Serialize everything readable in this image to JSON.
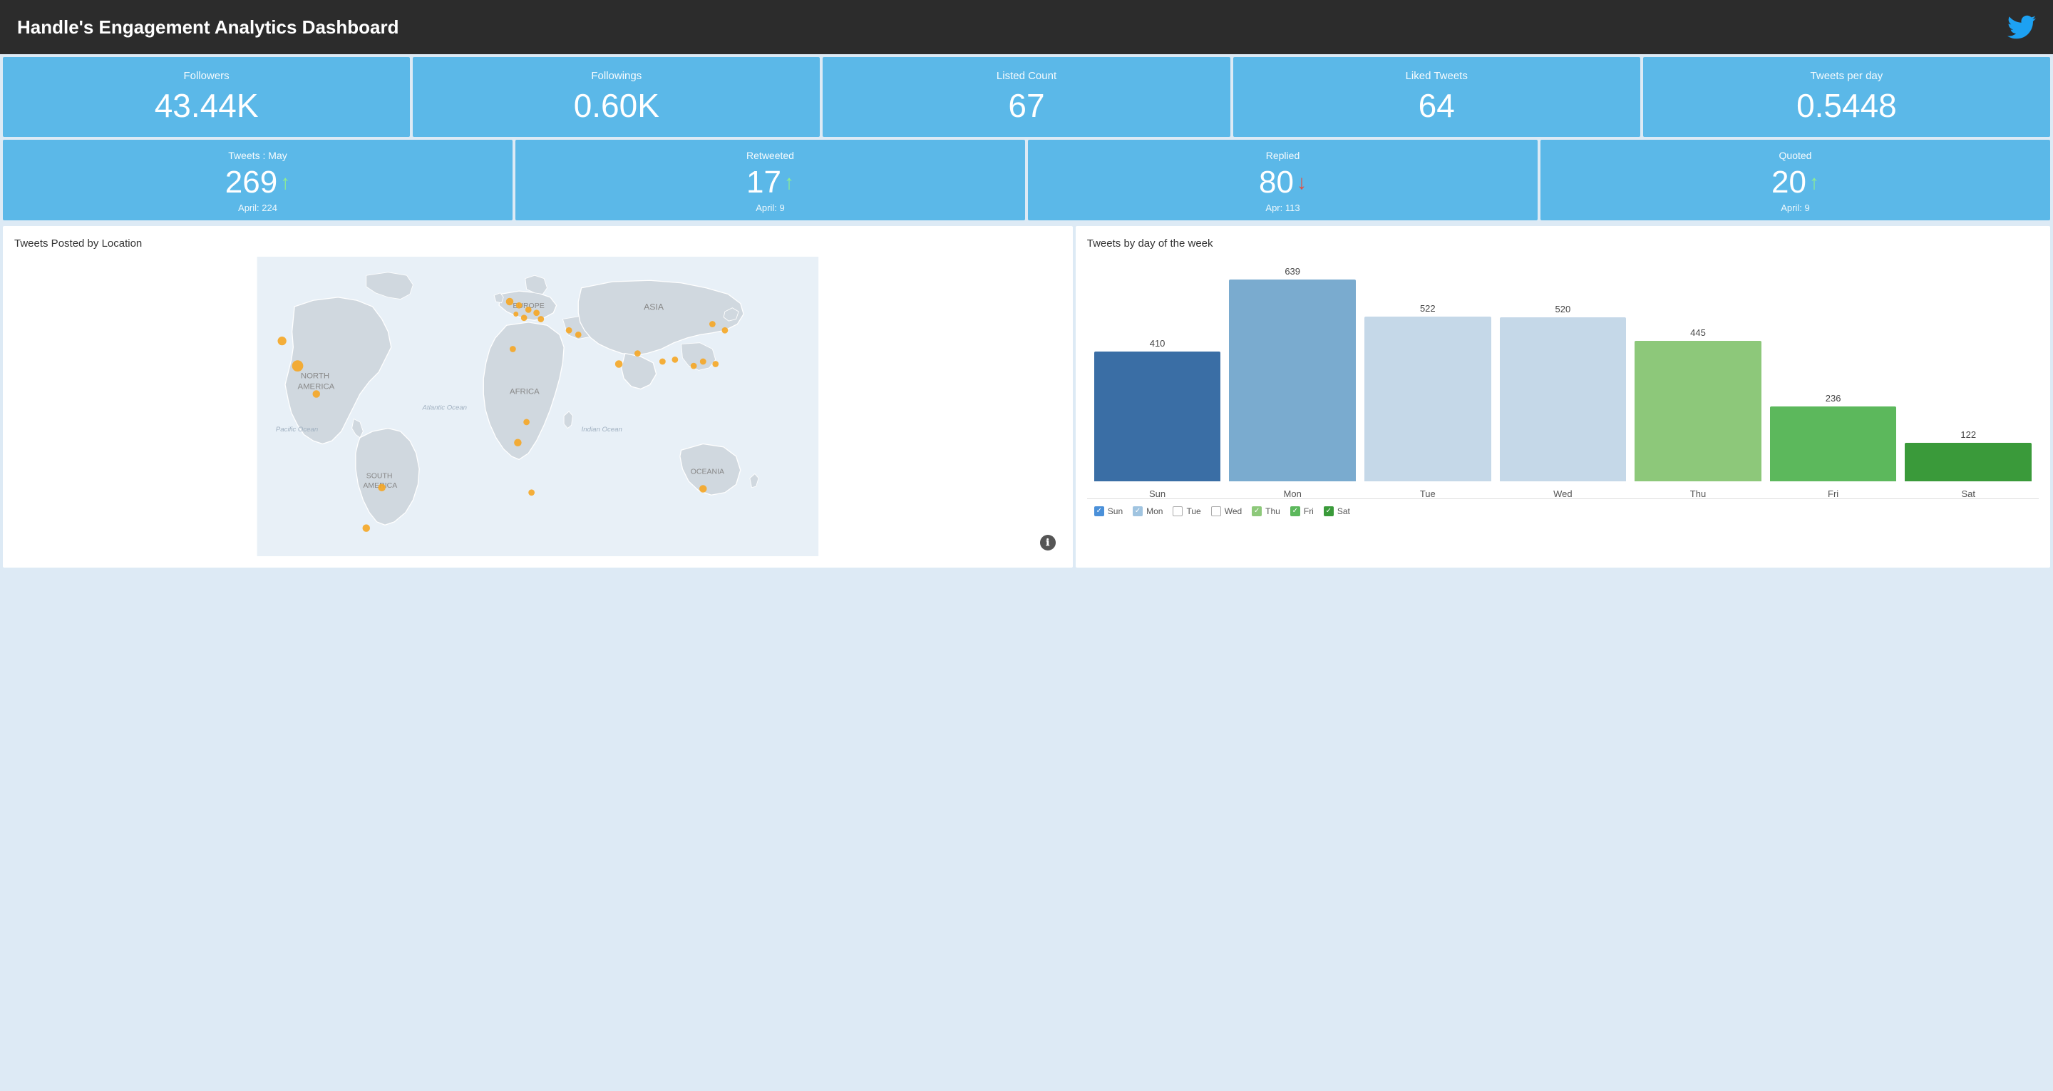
{
  "header": {
    "title": "Handle's Engagement Analytics Dashboard",
    "twitter_icon": "🐦"
  },
  "row1_cards": [
    {
      "label": "Followers",
      "value": "43.44K"
    },
    {
      "label": "Followings",
      "value": "0.60K"
    },
    {
      "label": "Listed Count",
      "value": "67"
    },
    {
      "label": "Liked Tweets",
      "value": "64"
    },
    {
      "label": "Tweets per day",
      "value": "0.5448"
    }
  ],
  "row2_cards": [
    {
      "label": "Tweets : May",
      "value": "269",
      "direction": "up",
      "prev_label": "April: 224"
    },
    {
      "label": "Retweeted",
      "value": "17",
      "direction": "up",
      "prev_label": "April: 9"
    },
    {
      "label": "Replied",
      "value": "80",
      "direction": "down",
      "prev_label": "Apr: 113"
    },
    {
      "label": "Quoted",
      "value": "20",
      "direction": "up",
      "prev_label": "April: 9"
    }
  ],
  "map_panel": {
    "title": "Tweets Posted by Location",
    "info_btn": "ℹ"
  },
  "chart_panel": {
    "title": "Tweets by day of the week",
    "bars": [
      {
        "day": "Sun",
        "value": 410,
        "color": "#3a6ea5",
        "legend_color": "#4a90d9",
        "checked": true
      },
      {
        "day": "Mon",
        "value": 639,
        "color": "#7aabcf",
        "legend_color": "#a0c4e0",
        "checked": true
      },
      {
        "day": "Tue",
        "value": 522,
        "color": "#c5d8e8",
        "legend_color": "#c5d8e8",
        "checked": false
      },
      {
        "day": "Wed",
        "value": 520,
        "color": "#c5d8e8",
        "legend_color": "#c5d8e8",
        "checked": false
      },
      {
        "day": "Thu",
        "value": 445,
        "color": "#8dc87a",
        "legend_color": "#8dc87a",
        "checked": true
      },
      {
        "day": "Fri",
        "value": 236,
        "color": "#5cb85c",
        "legend_color": "#5cb85c",
        "checked": true
      },
      {
        "day": "Sat",
        "value": 122,
        "color": "#3a9a3a",
        "legend_color": "#3a9a3a",
        "checked": true
      }
    ],
    "max_value": 700
  }
}
